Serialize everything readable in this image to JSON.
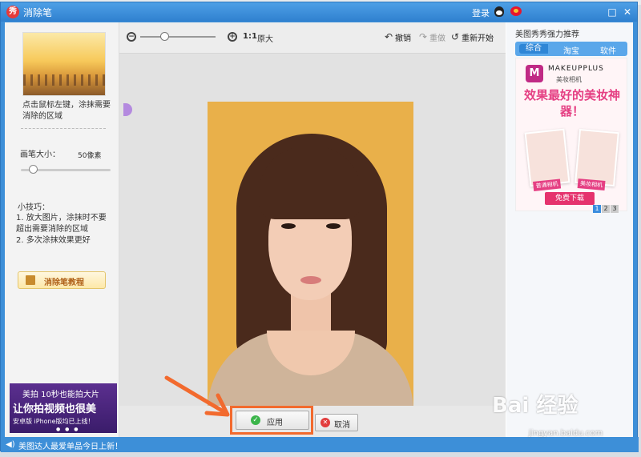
{
  "window": {
    "title": "消除笔",
    "login": "登录"
  },
  "left_panel": {
    "hint": "点击鼠标左键，涂抹需要消除的区域",
    "brush_label": "画笔大小：",
    "brush_value": "50像素",
    "brush_level": 0.1,
    "tips_title": "小技巧：",
    "tips": [
      "1. 放大图片，涂抹时不要超出需要消除的区域",
      "2. 多次涂抹效果更好"
    ],
    "tutorial_label": "消除笔教程",
    "banner": {
      "line1": "美拍 10秒也能拍大片",
      "line2": "让你拍视频也很美",
      "line3": "安卓版  iPhone版均已上线！"
    }
  },
  "toolbar": {
    "ratio": "1:1",
    "original": "原大",
    "undo": "撤销",
    "redo": "重做",
    "reset": "重新开始",
    "zoom_level": 0.3
  },
  "buttons": {
    "apply": "应用",
    "cancel": "取消"
  },
  "right_panel": {
    "title": "美图秀秀强力推荐",
    "tabs": [
      "综合",
      "淘宝",
      "软件"
    ],
    "ad": {
      "brand": "MAKEUPPLUS",
      "brand_cn": "美妆相机",
      "slogan": "效果最好的美妆神器！",
      "tag_left": "普通相机",
      "tag_right": "美妆相机",
      "download": "免费下载"
    },
    "pages": [
      "1",
      "2",
      "3"
    ]
  },
  "status": {
    "text": "美图达人最爱单品今日上新！"
  },
  "watermark": {
    "brand": "Bai 经验",
    "url": "jingyan.baidu.com"
  },
  "colors": {
    "accent": "#3d8fd8",
    "highlight": "#f26a2e"
  }
}
